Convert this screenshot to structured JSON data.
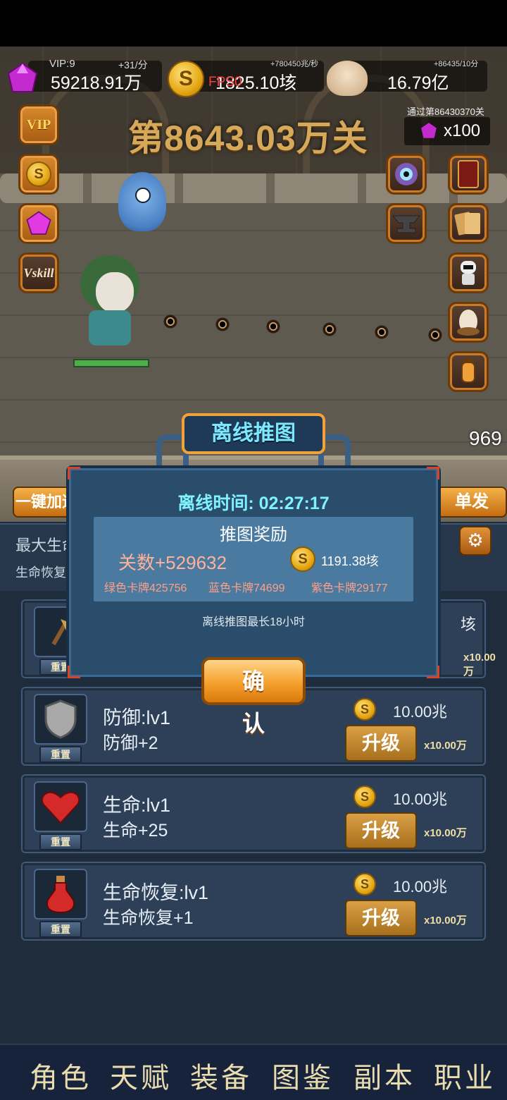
{
  "resources": {
    "vip_label": "VIP:9",
    "gem_rate": "+31/分",
    "gem_amount": "59218.91万",
    "gold_rate": "+780450兆/秒",
    "gold_amount": "1825.10垓",
    "fps_label": "FPS0",
    "skull_rate": "+86435/10分",
    "skull_amount": "16.79亿"
  },
  "stage": {
    "title": "第8643.03万关",
    "passed_label": "通过第86430370关",
    "gem_reward": "x100",
    "damage_text": "969"
  },
  "left_buttons": [
    {
      "label": "VIP"
    },
    {
      "label": "S"
    },
    {
      "label": "gem"
    },
    {
      "label": "Vskill"
    }
  ],
  "actions": {
    "left_button": "一键加速",
    "right_button": "单发"
  },
  "stats": {
    "line1": "最大生命",
    "line2": "生命恢复"
  },
  "cards": [
    {
      "name": "",
      "desc": "",
      "cost": "垓",
      "mult": "x10.00万",
      "reset": "重置",
      "icon": "axe-icon"
    },
    {
      "name": "防御:lv1",
      "desc": "防御+2",
      "cost": "10.00兆",
      "upgrade": "升级",
      "mult": "x10.00万",
      "reset": "重置",
      "icon": "shield-icon"
    },
    {
      "name": "生命:lv1",
      "desc": "生命+25",
      "cost": "10.00兆",
      "upgrade": "升级",
      "mult": "x10.00万",
      "reset": "重置",
      "icon": "heart-icon"
    },
    {
      "name": "生命恢复:lv1",
      "desc": "生命恢复+1",
      "cost": "10.00兆",
      "upgrade": "升级",
      "mult": "x10.00万",
      "reset": "重置",
      "icon": "potion-icon"
    }
  ],
  "modal": {
    "title": "离线推图",
    "time_label": "离线时间: 02:27:17",
    "reward_title": "推图奖励",
    "stage_gain": "关数+529632",
    "gold_gain": "1191.38垓",
    "cards": {
      "green": "绿色卡牌425756",
      "blue": "蓝色卡牌74699",
      "purple": "紫色卡牌29177"
    },
    "note": "离线推图最长18小时",
    "confirm": "确 认"
  },
  "nav": [
    "角色",
    "天赋",
    "装备",
    "图鉴",
    "副本",
    "职业"
  ],
  "colors": {
    "accent_orange": "#f2a23a",
    "modal_bg": "#2a4d6c",
    "title_cyan": "#7ce8ff",
    "stage_gold": "#d6a85a"
  }
}
